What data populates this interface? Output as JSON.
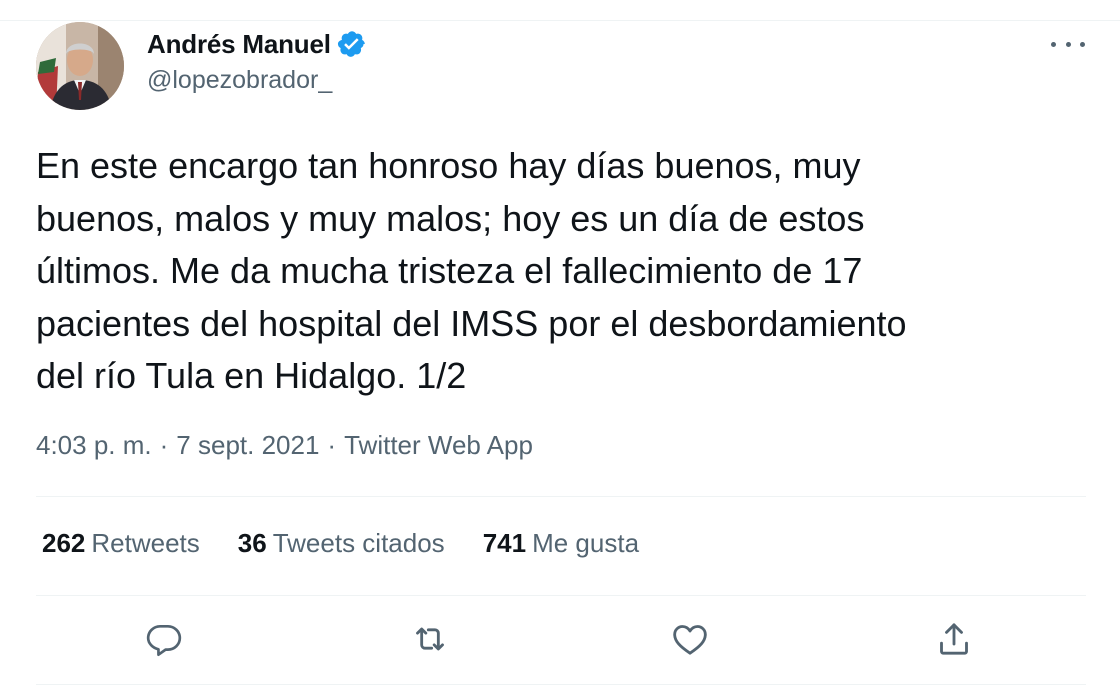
{
  "author": {
    "display_name": "Andrés Manuel",
    "handle": "@lopezobrador_"
  },
  "icons": {
    "verified": "verified-badge-icon",
    "more": "more-options-icon",
    "reply": "reply-icon",
    "retweet": "retweet-icon",
    "like": "like-icon",
    "share": "share-icon"
  },
  "tweet": {
    "lines": [
      "En este encargo tan honroso hay días buenos, muy",
      "buenos, malos y muy malos; hoy es un día de estos",
      "últimos. Me da mucha tristeza el fallecimiento de 17",
      "pacientes del hospital del IMSS por el desbordamiento",
      "del río Tula en Hidalgo. 1/2"
    ]
  },
  "meta": {
    "time": "4:03 p. m.",
    "separator": "·",
    "date": "7 sept. 2021",
    "source": "Twitter Web App"
  },
  "stats": {
    "retweets_count": "262",
    "retweets_label": "Retweets",
    "quotes_count": "36",
    "quotes_label": "Tweets citados",
    "likes_count": "741",
    "likes_label": "Me gusta"
  },
  "colors": {
    "text": "#0f1419",
    "secondary": "#536471",
    "verified": "#1d9bf0",
    "divider": "#eff3f4"
  }
}
